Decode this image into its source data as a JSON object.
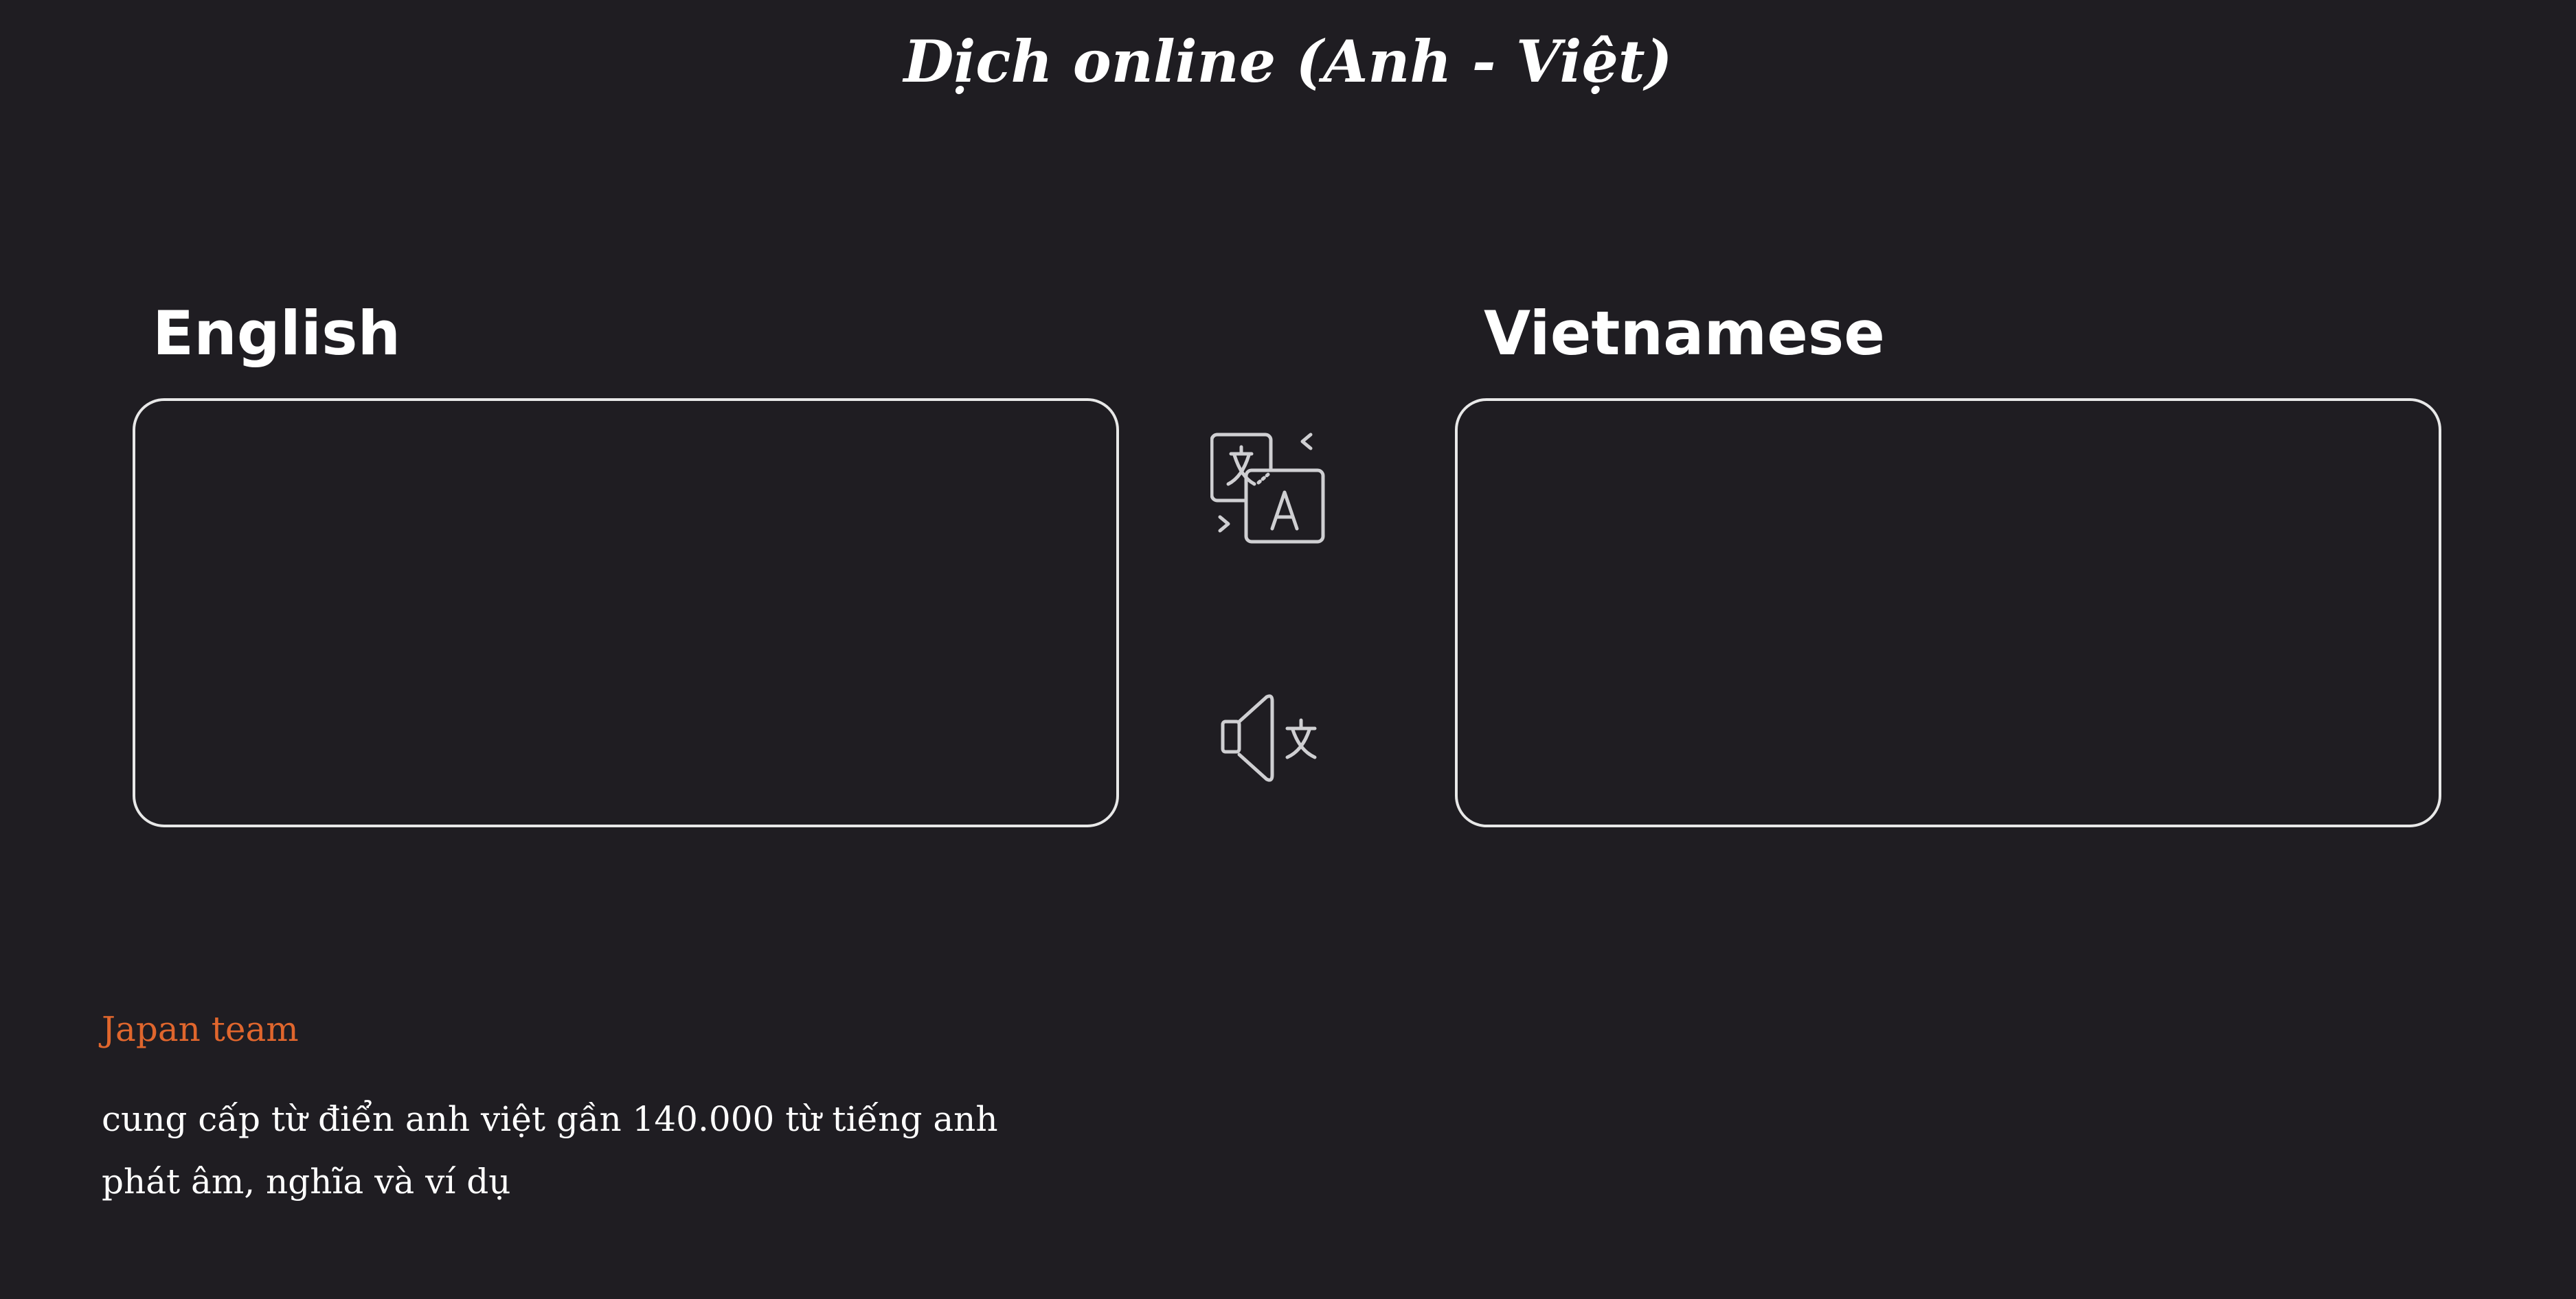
{
  "header": {
    "title": "Dịch online (Anh - Việt)"
  },
  "source": {
    "label": "English",
    "value": ""
  },
  "target": {
    "label": "Vietnamese",
    "value": ""
  },
  "actions": {
    "translate_icon": "translate-icon",
    "speak_icon": "text-to-speech-icon"
  },
  "footer": {
    "brand": "Japan team",
    "lines": [
      "cung cấp từ điển anh việt gần 140.000 từ tiếng anh",
      "phát âm, nghĩa và ví dụ"
    ]
  },
  "colors": {
    "background": "#1f1d22",
    "border": "#e8e8e8",
    "accent": "#e0662d",
    "text": "#ffffff",
    "icon": "#cfcfd2"
  }
}
